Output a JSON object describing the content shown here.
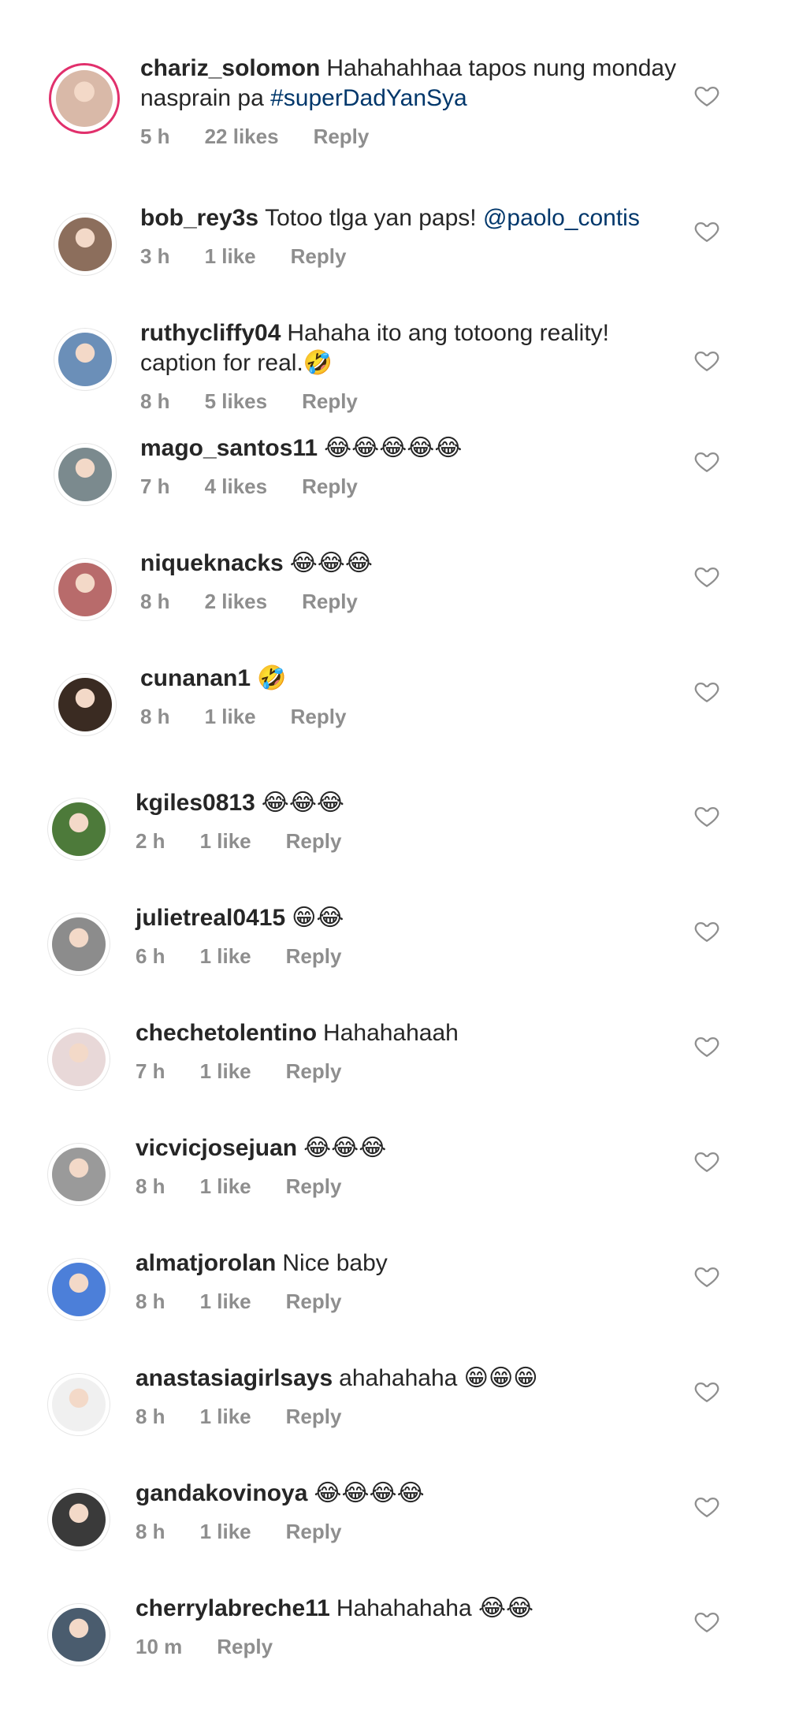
{
  "comments": [
    {
      "user": "chariz_solomon",
      "text": "Hahahahhaa tapos nung monday nasprain pa ",
      "tag": "#superDadYanSya",
      "time": "5 h",
      "likes": "22 likes",
      "reply": "Reply"
    },
    {
      "user": "bob_rey3s",
      "text": "Totoo tlga yan paps! ",
      "tag": "@paolo_contis",
      "time": "3 h",
      "likes": "1 like",
      "reply": "Reply"
    },
    {
      "user": "ruthycliffy04",
      "text": "Hahaha ito ang totoong reality! caption for real.🤣",
      "time": "8 h",
      "likes": "5 likes",
      "reply": "Reply"
    },
    {
      "user": "mago_santos11",
      "text": "😂😂😂😂😂",
      "time": "7 h",
      "likes": "4 likes",
      "reply": "Reply"
    },
    {
      "user": "niqueknacks",
      "text": "😂😂😂",
      "time": "8 h",
      "likes": "2 likes",
      "reply": "Reply"
    },
    {
      "user": "cunanan1",
      "text": "🤣",
      "time": "8 h",
      "likes": "1 like",
      "reply": "Reply"
    },
    {
      "user": "kgiles0813",
      "text": "😂😂😂",
      "time": "2 h",
      "likes": "1 like",
      "reply": "Reply"
    },
    {
      "user": "julietreal0415",
      "text": "😁😂",
      "time": "6 h",
      "likes": "1 like",
      "reply": "Reply"
    },
    {
      "user": "chechetolentino",
      "text": "Hahahahaah",
      "time": "7 h",
      "likes": "1 like",
      "reply": "Reply"
    },
    {
      "user": "vicvicjosejuan",
      "text": "😂😂😂",
      "time": "8 h",
      "likes": "1 like",
      "reply": "Reply"
    },
    {
      "user": "almatjorolan",
      "text": "Nice baby",
      "time": "8 h",
      "likes": "1 like",
      "reply": "Reply"
    },
    {
      "user": "anastasiagirlsays",
      "text": "ahahahaha 😁😁😁",
      "time": "8 h",
      "likes": "1 like",
      "reply": "Reply"
    },
    {
      "user": "gandakovinoya",
      "text": "😂😂😂😂",
      "time": "8 h",
      "likes": "1 like",
      "reply": "Reply"
    },
    {
      "user": "cherrylabreche11",
      "text": "Hahahahaha 😂😂",
      "time": "10 m",
      "reply": "Reply"
    }
  ],
  "icons": {
    "like": "heart-outline-icon"
  },
  "colors": {
    "text": "#262626",
    "meta": "#8e8e8e",
    "link": "#00376b",
    "story_ring": "#e1306c"
  }
}
